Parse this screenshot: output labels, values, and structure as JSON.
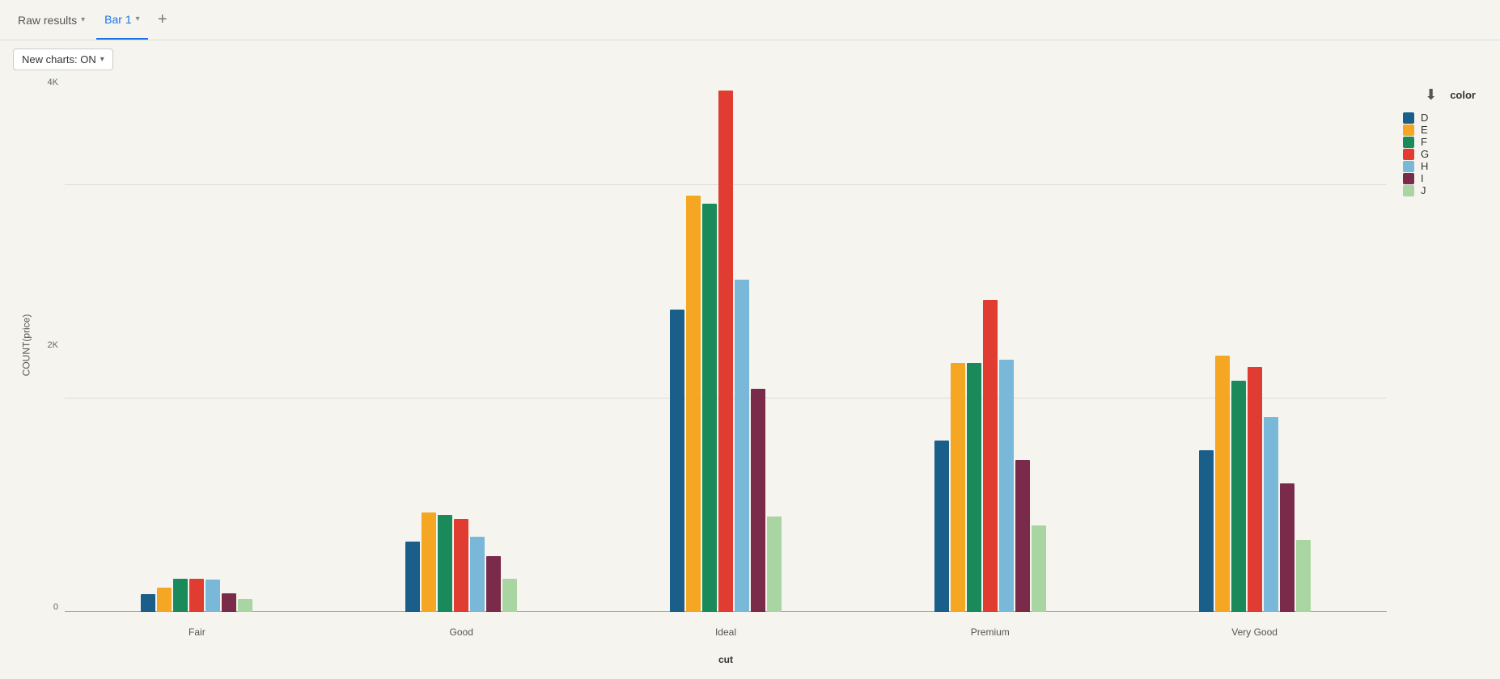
{
  "tabs": [
    {
      "id": "raw-results",
      "label": "Raw results",
      "active": false,
      "hasChevron": true
    },
    {
      "id": "bar1",
      "label": "Bar 1",
      "active": true,
      "hasChevron": true
    }
  ],
  "tab_add_label": "+",
  "toolbar": {
    "new_charts_label": "New charts: ON"
  },
  "chart": {
    "y_axis_title": "COUNT(price)",
    "x_axis_title": "cut",
    "y_labels": [
      "4K",
      "2K",
      "0"
    ],
    "y_max": 5000,
    "groups": [
      {
        "label": "Fair",
        "bars": [
          {
            "color_id": "D",
            "value": 163,
            "color": "#1a5f8a"
          },
          {
            "color_id": "E",
            "value": 224,
            "color": "#f5a623"
          },
          {
            "color_id": "F",
            "value": 312,
            "color": "#1a8a5a"
          },
          {
            "color_id": "G",
            "value": 314,
            "color": "#e03c31"
          },
          {
            "color_id": "H",
            "value": 303,
            "color": "#7ab8d9"
          },
          {
            "color_id": "I",
            "value": 175,
            "color": "#7a2b4a"
          },
          {
            "color_id": "J",
            "value": 119,
            "color": "#a8d5a2"
          }
        ]
      },
      {
        "label": "Good",
        "bars": [
          {
            "color_id": "D",
            "value": 662,
            "color": "#1a5f8a"
          },
          {
            "color_id": "E",
            "value": 933,
            "color": "#f5a623"
          },
          {
            "color_id": "F",
            "value": 909,
            "color": "#1a8a5a"
          },
          {
            "color_id": "G",
            "value": 871,
            "color": "#e03c31"
          },
          {
            "color_id": "H",
            "value": 702,
            "color": "#7ab8d9"
          },
          {
            "color_id": "I",
            "value": 522,
            "color": "#7a2b4a"
          },
          {
            "color_id": "J",
            "value": 307,
            "color": "#a8d5a2"
          }
        ]
      },
      {
        "label": "Ideal",
        "bars": [
          {
            "color_id": "D",
            "value": 2834,
            "color": "#1a5f8a"
          },
          {
            "color_id": "E",
            "value": 3903,
            "color": "#f5a623"
          },
          {
            "color_id": "F",
            "value": 3826,
            "color": "#1a8a5a"
          },
          {
            "color_id": "G",
            "value": 4884,
            "color": "#e03c31"
          },
          {
            "color_id": "H",
            "value": 3115,
            "color": "#7ab8d9"
          },
          {
            "color_id": "I",
            "value": 2093,
            "color": "#7a2b4a"
          },
          {
            "color_id": "J",
            "value": 896,
            "color": "#a8d5a2"
          }
        ]
      },
      {
        "label": "Premium",
        "bars": [
          {
            "color_id": "D",
            "value": 1603,
            "color": "#1a5f8a"
          },
          {
            "color_id": "E",
            "value": 2337,
            "color": "#f5a623"
          },
          {
            "color_id": "F",
            "value": 2331,
            "color": "#1a8a5a"
          },
          {
            "color_id": "G",
            "value": 2924,
            "color": "#e03c31"
          },
          {
            "color_id": "H",
            "value": 2360,
            "color": "#7ab8d9"
          },
          {
            "color_id": "I",
            "value": 1428,
            "color": "#7a2b4a"
          },
          {
            "color_id": "J",
            "value": 808,
            "color": "#a8d5a2"
          }
        ]
      },
      {
        "label": "Very Good",
        "bars": [
          {
            "color_id": "D",
            "value": 1513,
            "color": "#1a5f8a"
          },
          {
            "color_id": "E",
            "value": 2400,
            "color": "#f5a623"
          },
          {
            "color_id": "F",
            "value": 2164,
            "color": "#1a8a5a"
          },
          {
            "color_id": "G",
            "value": 2299,
            "color": "#e03c31"
          },
          {
            "color_id": "H",
            "value": 1824,
            "color": "#7ab8d9"
          },
          {
            "color_id": "I",
            "value": 1204,
            "color": "#7a2b4a"
          },
          {
            "color_id": "J",
            "value": 678,
            "color": "#a8d5a2"
          }
        ]
      }
    ],
    "legend_title": "color",
    "legend_items": [
      {
        "id": "D",
        "label": "D",
        "color": "#1a5f8a"
      },
      {
        "id": "E",
        "label": "E",
        "color": "#f5a623"
      },
      {
        "id": "F",
        "label": "F",
        "color": "#1a8a5a"
      },
      {
        "id": "G",
        "label": "G",
        "color": "#e03c31"
      },
      {
        "id": "H",
        "label": "H",
        "color": "#7ab8d9"
      },
      {
        "id": "I",
        "label": "I",
        "color": "#7a2b4a"
      },
      {
        "id": "J",
        "label": "J",
        "color": "#a8d5a2"
      }
    ]
  }
}
